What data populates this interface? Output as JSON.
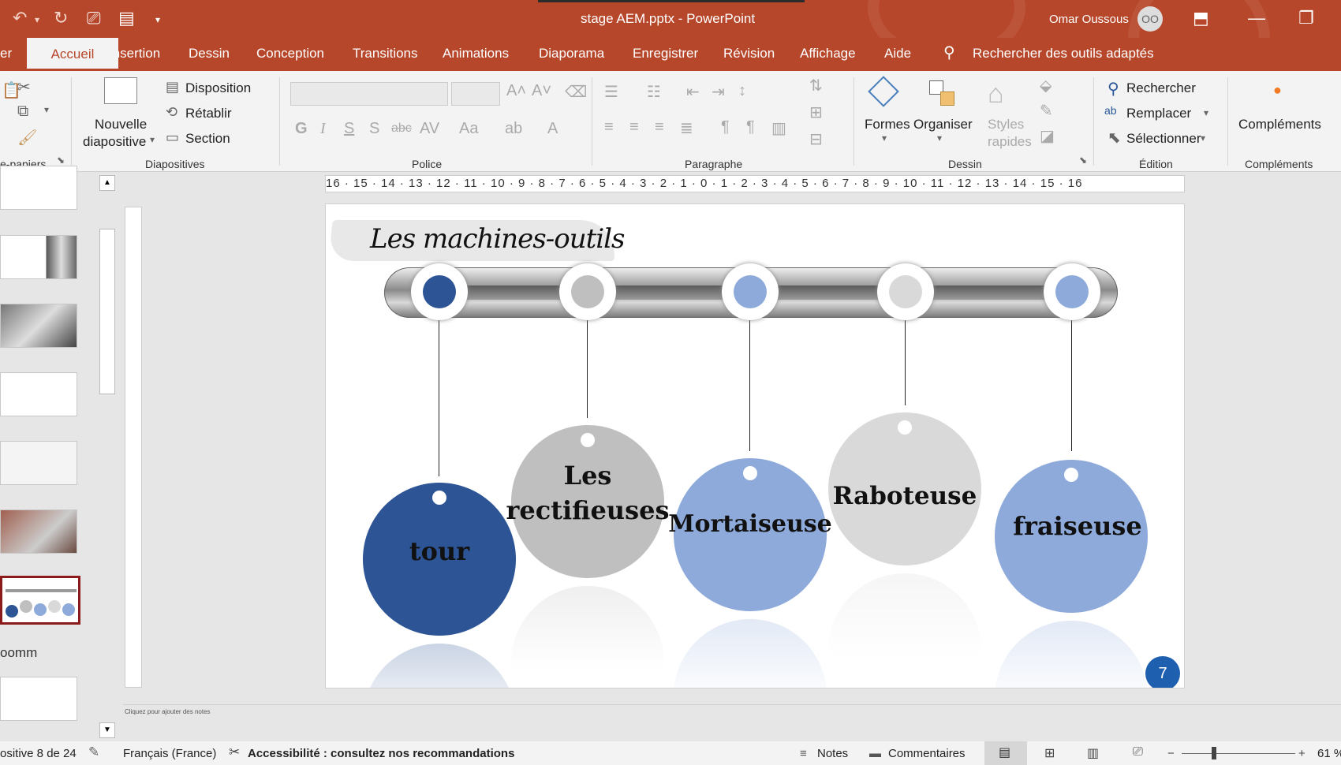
{
  "window": {
    "title": "stage AEM.pptx  -  PowerPoint",
    "user": "Omar Oussous",
    "user_initials": "OO"
  },
  "tabs": [
    "er",
    "Insertion",
    "Dessin",
    "Conception",
    "Transitions",
    "Animations",
    "Diaporama",
    "Enregistrer",
    "Révision",
    "Affichage",
    "Aide"
  ],
  "active_tab": "Accueil",
  "tell_me": "Rechercher des outils adaptés",
  "ribbon": {
    "clipboard_label": "e-papiers",
    "slides": {
      "new_slide": "Nouvelle",
      "new_slide_2": "diapositive",
      "layout": "Disposition",
      "reset": "Rétablir",
      "section": "Section",
      "label": "Diapositives"
    },
    "font_label": "Police",
    "paragraph_label": "Paragraphe",
    "drawing": {
      "shapes": "Formes",
      "arrange": "Organiser",
      "styles": "Styles",
      "styles_2": "rapides",
      "label": "Dessin"
    },
    "editing": {
      "find": "Rechercher",
      "replace": "Remplacer",
      "select": "Sélectionner",
      "label": "Édition"
    },
    "addins": {
      "button": "Compléments",
      "label": "Compléments"
    }
  },
  "thumbnail_section": "oomm",
  "ruler_h": "16 · 15 · 14 · 13 · 12 · 11 · 10 · 9 · 8 · 7 · 6 · 5 · 4 · 3 · 2 · 1 · 0 · 1 · 2 · 3 · 4 · 5 · 6 · 7 · 8 · 9 · 10 · 11 · 12 · 13 · 14 · 15 · 16",
  "slide": {
    "title": "Les machines-outils",
    "items": [
      {
        "line1": "tour",
        "line2": "",
        "color": "#2d5495"
      },
      {
        "line1": "Les",
        "line2": "rectifieuses",
        "color": "#bfbfbf"
      },
      {
        "line1": "Mortaiseuse",
        "line2": "",
        "color": "#8eaadb"
      },
      {
        "line1": "Raboteuse",
        "line2": "",
        "color": "#d9d9d9"
      },
      {
        "line1": "fraiseuse",
        "line2": "",
        "color": "#8eaadb"
      }
    ],
    "page_number": "7"
  },
  "notes_placeholder": "Cliquez pour ajouter des notes",
  "status": {
    "slide_counter": "ositive 8 de 24",
    "language": "Français (France)",
    "accessibility": "Accessibilité : consultez nos recommandations",
    "notes": "Notes",
    "comments": "Commentaires",
    "zoom": "61 %"
  }
}
